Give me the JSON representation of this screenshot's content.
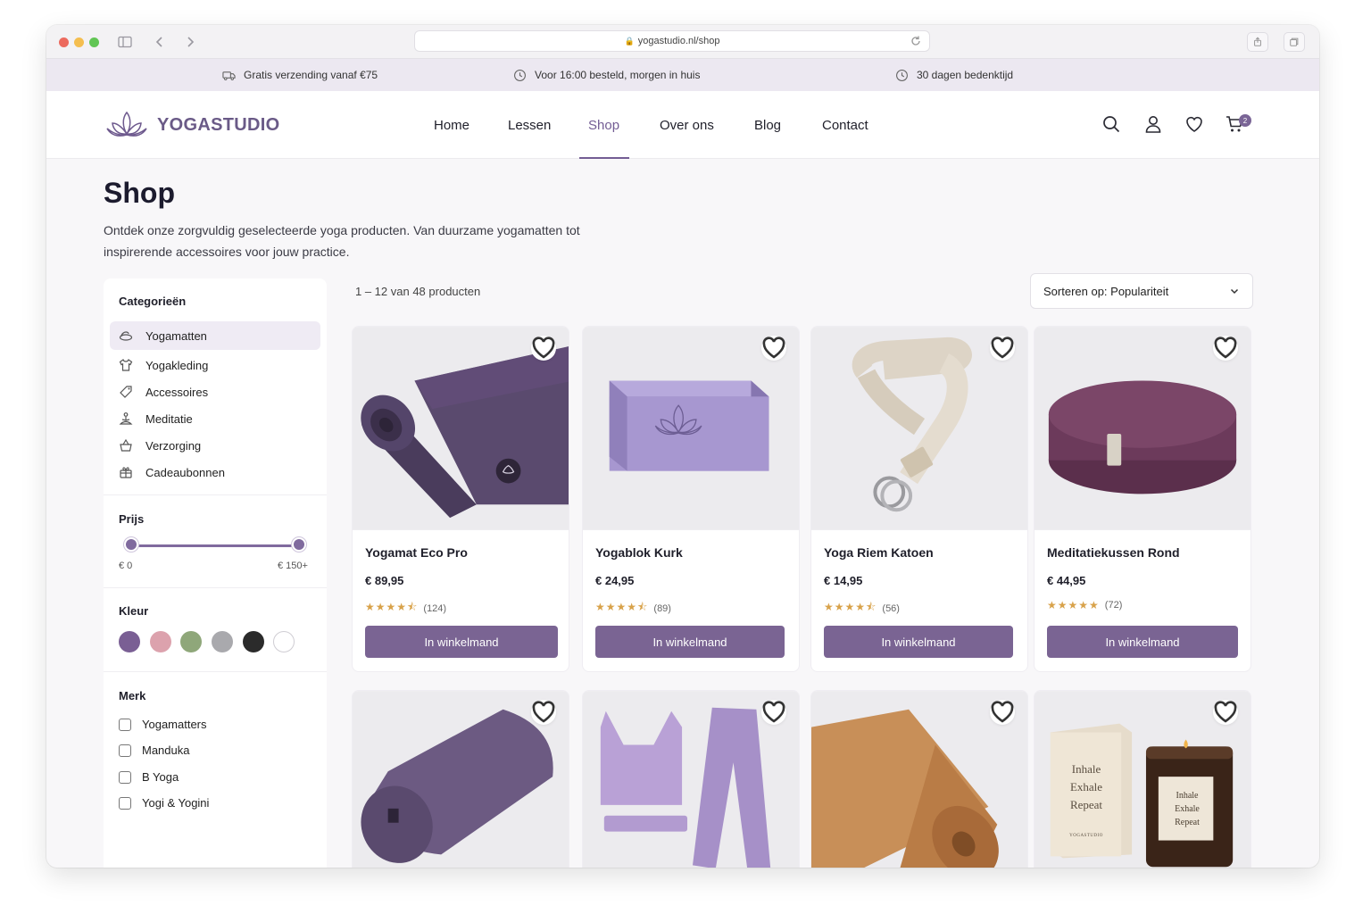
{
  "browser": {
    "url": "yogastudio.nl/shop"
  },
  "promo": [
    {
      "text": "Gratis verzending vanaf €75",
      "icon": "truck-icon"
    },
    {
      "text": "Voor 16:00 besteld, morgen in huis",
      "icon": "clock-icon"
    },
    {
      "text": "30 dagen bedenktijd",
      "icon": "clock-icon"
    }
  ],
  "header": {
    "logo": "YOGASTUDIO",
    "nav": [
      "Home",
      "Lessen",
      "Shop",
      "Over ons",
      "Blog",
      "Contact"
    ],
    "active_nav": "Shop",
    "cart_count": "2"
  },
  "page": {
    "title": "Shop",
    "intro": "Ontdek onze zorgvuldig geselecteerde yoga producten. Van duurzame yogamatten tot inspirerende accessoires voor jouw practice."
  },
  "sidebar": {
    "categories_title": "Categorieën",
    "categories": [
      {
        "label": "Yogamatten",
        "icon": "mat-icon",
        "active": true
      },
      {
        "label": "Yogakleding",
        "icon": "shirt-icon",
        "active": false
      },
      {
        "label": "Accessoires",
        "icon": "tag-icon",
        "active": false
      },
      {
        "label": "Meditatie",
        "icon": "meditation-icon",
        "active": false
      },
      {
        "label": "Verzorging",
        "icon": "basket-icon",
        "active": false
      },
      {
        "label": "Cadeaubonnen",
        "icon": "gift-icon",
        "active": false
      }
    ],
    "price_title": "Prijs",
    "price_min": "€ 0",
    "price_max": "€ 150+",
    "color_title": "Kleur",
    "colors": [
      "#7a5f94",
      "#dca2ad",
      "#8fa77a",
      "#a9a9ad",
      "#2b2b2b",
      "#ffffff"
    ],
    "brand_title": "Merk",
    "brands": [
      "Yogamatters",
      "Manduka",
      "B Yoga",
      "Yogi & Yogini"
    ]
  },
  "results": {
    "count": "1 – 12 van 48 producten",
    "sort_label": "Sorteren op: Populariteit"
  },
  "products": [
    {
      "name": "Yogamat Eco Pro",
      "price": "€ 89,95",
      "stars": "★★★★⯪",
      "reviews": "(124)",
      "button": "In winkelmand"
    },
    {
      "name": "Yogablok Kurk",
      "price": "€ 24,95",
      "stars": "★★★★⯪",
      "reviews": "(89)",
      "button": "In winkelmand"
    },
    {
      "name": "Yoga Riem Katoen",
      "price": "€ 14,95",
      "stars": "★★★★⯪",
      "reviews": "(56)",
      "button": "In winkelmand"
    },
    {
      "name": "Meditatiekussen Rond",
      "price": "€ 44,95",
      "stars": "★★★★★",
      "reviews": "(72)",
      "button": "In winkelmand"
    }
  ],
  "candle_text": {
    "box_lines": [
      "Inhale",
      "Exhale",
      "Repeat"
    ],
    "box_brand": "YOGASTUDIO"
  },
  "colors": {
    "accent": "#7a6493",
    "promo_bg": "#ece8f1"
  }
}
